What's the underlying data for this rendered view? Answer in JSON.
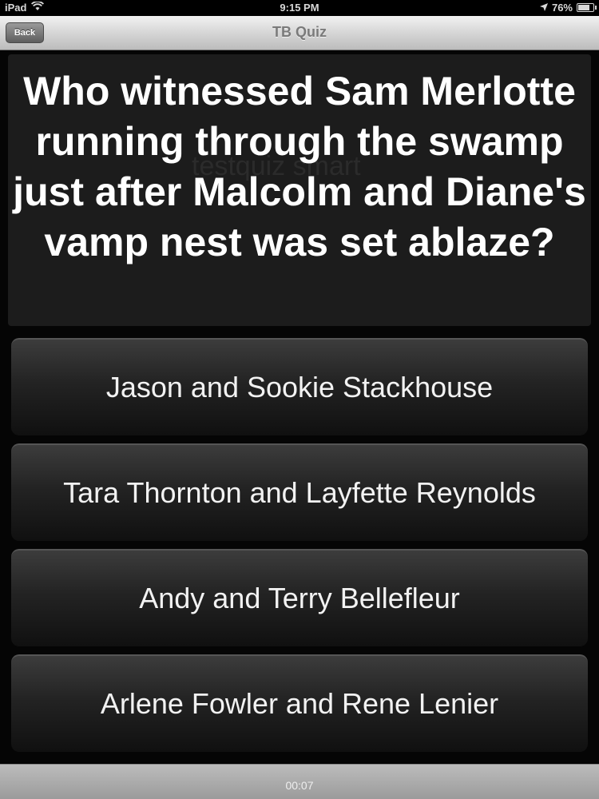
{
  "status_bar": {
    "device": "iPad",
    "time": "9:15 PM",
    "battery": "76%",
    "battery_level": 0.76
  },
  "nav": {
    "back_label": "Back",
    "title": "TB Quiz"
  },
  "question": {
    "text": "Who witnessed Sam Merlotte running through the swamp just after Malcolm and Diane's vamp nest was set ablaze?",
    "watermark": "testquiz smart"
  },
  "answers": [
    {
      "label": "Jason and Sookie Stackhouse"
    },
    {
      "label": "Tara Thornton and Layfette Reynolds"
    },
    {
      "label": "Andy and Terry Bellefleur"
    },
    {
      "label": "Arlene Fowler and Rene Lenier"
    }
  ],
  "footer": {
    "timer": "00:07"
  },
  "icons": {
    "wifi": "wifi-icon",
    "location": "location-arrow-icon",
    "battery": "battery-icon"
  }
}
